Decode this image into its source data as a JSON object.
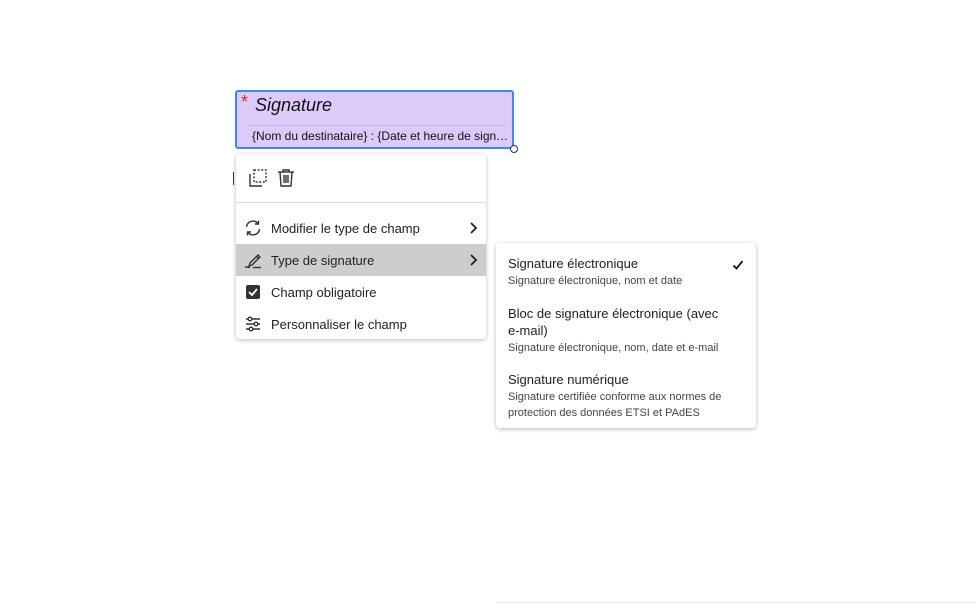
{
  "signature_field": {
    "required_marker": "*",
    "title": "Signature",
    "detail": "{Nom du destinataire} : {Date et heure de signature}"
  },
  "context_menu": {
    "toolbar": {
      "duplicate_icon": "duplicate-icon",
      "delete_icon": "trash-icon"
    },
    "items": [
      {
        "label": "Modifier le type de champ",
        "icon": "refresh-icon",
        "has_submenu": true
      },
      {
        "label": "Type de signature",
        "icon": "pen-sign-icon",
        "has_submenu": true,
        "active": true
      },
      {
        "label": "Champ obligatoire",
        "icon": "checkbox-checked-icon",
        "checked": true
      },
      {
        "label": "Personnaliser le champ",
        "icon": "sliders-icon"
      }
    ]
  },
  "signature_type_submenu": {
    "options": [
      {
        "title": "Signature électronique",
        "description": "Signature électronique, nom et date",
        "selected": true
      },
      {
        "title": "Bloc de signature électronique (avec e-mail)",
        "description": "Signature électronique, nom, date et e-mail"
      },
      {
        "title": "Signature numérique",
        "description": "Signature certifiée conforme aux normes de protection des données ETSI et PAdES"
      }
    ]
  },
  "colors": {
    "field_fill": "#dccafa",
    "field_border": "#3f86f5",
    "required_marker": "#d7262a",
    "active_item_bg": "#cdcdcd"
  }
}
